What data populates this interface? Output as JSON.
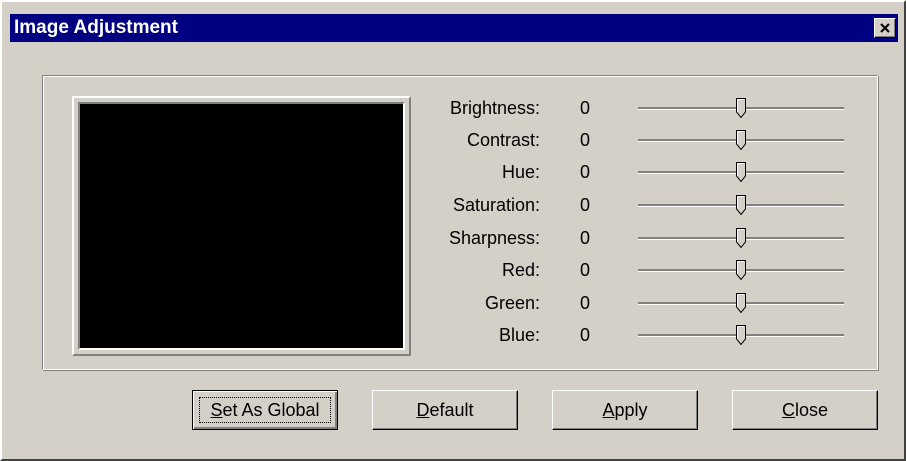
{
  "window": {
    "title": "Image Adjustment",
    "close_icon": "close-x-icon"
  },
  "adjustments": [
    {
      "label": "Brightness:",
      "value": "0",
      "level": 0.5
    },
    {
      "label": "Contrast:",
      "value": "0",
      "level": 0.5
    },
    {
      "label": "Hue:",
      "value": "0",
      "level": 0.5
    },
    {
      "label": "Saturation:",
      "value": "0",
      "level": 0.5
    },
    {
      "label": "Sharpness:",
      "value": "0",
      "level": 0.5
    },
    {
      "label": "Red:",
      "value": "0",
      "level": 0.5
    },
    {
      "label": "Green:",
      "value": "0",
      "level": 0.5
    },
    {
      "label": "Blue:",
      "value": "0",
      "level": 0.5
    }
  ],
  "buttons": {
    "set_as_global": {
      "mnemonic": "S",
      "rest": "et As Global"
    },
    "default": {
      "mnemonic": "D",
      "rest": "efault"
    },
    "apply": {
      "mnemonic": "A",
      "rest": "pply"
    },
    "close": {
      "mnemonic": "C",
      "rest": "lose"
    }
  },
  "colors": {
    "title_bar": "#000080",
    "face": "#d4d0c8",
    "preview_bg": "#000000"
  }
}
